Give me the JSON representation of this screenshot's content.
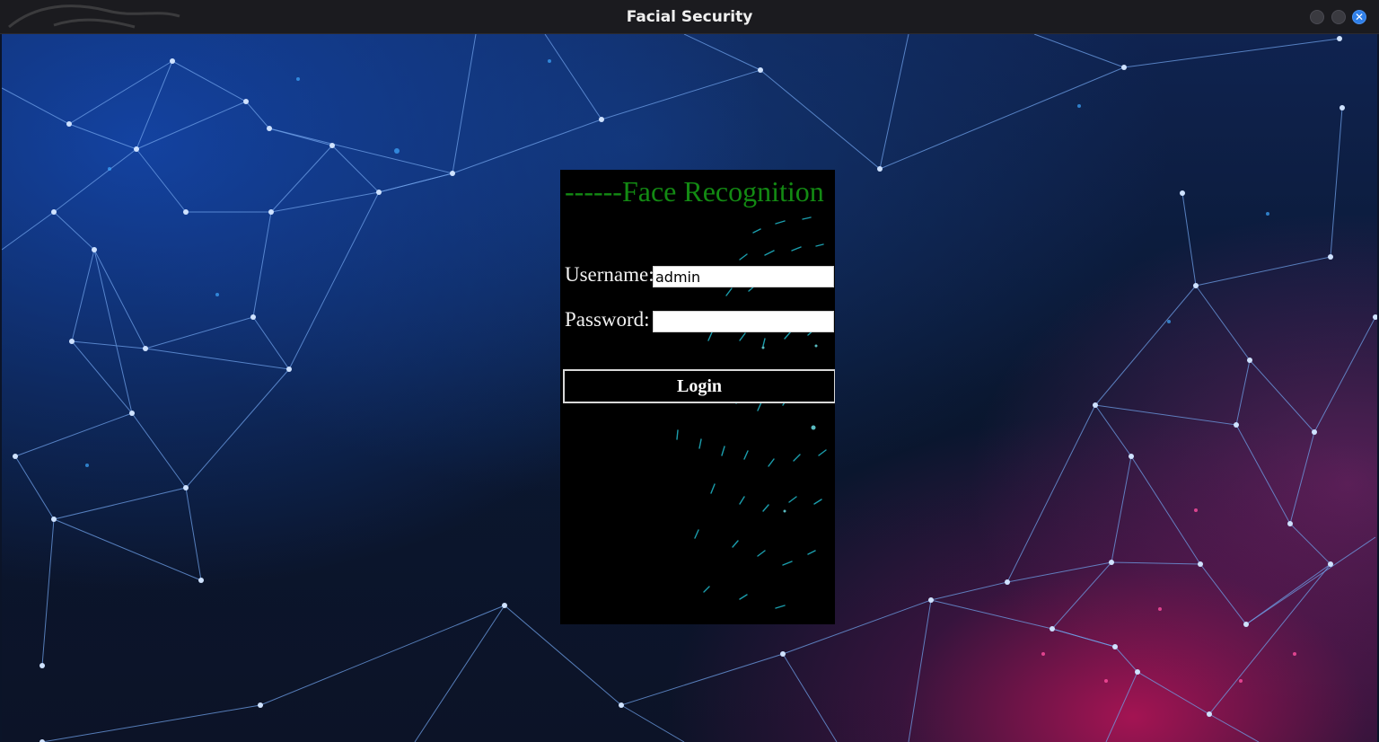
{
  "window": {
    "title": "Facial Security",
    "close_glyph": "✕"
  },
  "login": {
    "heading": "------Face Recognition",
    "username_label": "Username:",
    "username_value": "admin",
    "password_label": "Password:",
    "password_value": "",
    "login_label": "Login"
  },
  "colors": {
    "heading": "#138a13",
    "panel_bg": "#000000",
    "close_button": "#2f7fe8"
  }
}
